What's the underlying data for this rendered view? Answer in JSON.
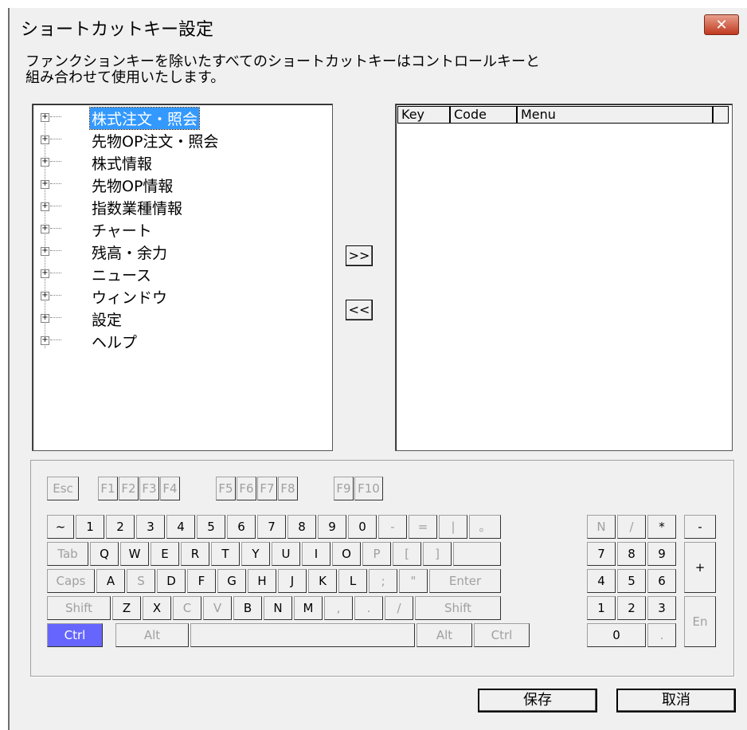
{
  "window": {
    "title": "ショートカットキー設定",
    "close": "✕"
  },
  "description": {
    "line1": "ファンクションキーを除いたすべてのショートカットキーはコントロールキーと",
    "line2": "組み合わせて使用いたします。"
  },
  "tree": {
    "items": [
      {
        "label": "株式注文・照会",
        "selected": true
      },
      {
        "label": "先物OP注文・照会"
      },
      {
        "label": "株式情報"
      },
      {
        "label": "先物OP情報"
      },
      {
        "label": "指数業種情報"
      },
      {
        "label": "チャート"
      },
      {
        "label": "残高・余力"
      },
      {
        "label": "ニュース"
      },
      {
        "label": "ウィンドウ"
      },
      {
        "label": "設定"
      },
      {
        "label": "ヘルプ"
      }
    ],
    "expander": "+"
  },
  "transfer": {
    "add": ">>",
    "remove": "<<"
  },
  "list": {
    "columns": [
      "Key",
      "Code",
      "Menu",
      ""
    ]
  },
  "keyboard": {
    "row0": [
      "Esc",
      "F1",
      "F2",
      "F3",
      "F4",
      "F5",
      "F6",
      "F7",
      "F8",
      "F9",
      "F10"
    ],
    "row1": [
      "~",
      "1",
      "2",
      "3",
      "4",
      "5",
      "6",
      "7",
      "8",
      "9",
      "0",
      "-",
      "=",
      "|",
      "。"
    ],
    "row2": [
      "Tab",
      "Q",
      "W",
      "E",
      "R",
      "T",
      "Y",
      "U",
      "I",
      "O",
      "P",
      "[",
      "]",
      ""
    ],
    "row3": [
      "Caps",
      "A",
      "S",
      "D",
      "F",
      "G",
      "H",
      "J",
      "K",
      "L",
      ";",
      "\"",
      "Enter"
    ],
    "row4": [
      "Shift",
      "Z",
      "X",
      "C",
      "V",
      "B",
      "N",
      "M",
      ",",
      ".",
      "/",
      "Shift"
    ],
    "row5": [
      "Ctrl",
      "Alt",
      "",
      "Alt",
      "Ctrl"
    ],
    "numpad": {
      "r1": [
        "N",
        "/",
        "*",
        "-"
      ],
      "r2": [
        "7",
        "8",
        "9",
        "+"
      ],
      "r3": [
        "4",
        "5",
        "6"
      ],
      "r4": [
        "1",
        "2",
        "3",
        "En"
      ],
      "r5": [
        "0",
        "."
      ]
    }
  },
  "buttons": {
    "save": "保存",
    "cancel": "取消"
  },
  "colors": {
    "selected_bg": "#3399ff",
    "active_key_bg": "#6666ff",
    "close_bg": "#c0391f"
  }
}
